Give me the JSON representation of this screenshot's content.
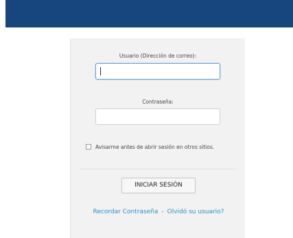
{
  "login": {
    "email_label": "Usuario (Dirección de correo):",
    "password_label": "Contraseña:",
    "email_value": "",
    "password_value": "",
    "remember_label": "Avisarme antes de abrir sesión en otros sitios.",
    "remember_checked": false,
    "submit_label": "INICIAR SESIÓN",
    "forgot_password_link": "Recordar Contraseña",
    "link_separator": "-",
    "forgot_user_link": "Olvidó su usuario?"
  },
  "colors": {
    "header_bar": "#17467e",
    "link": "#2a8fc4",
    "panel_bg": "#f2f2f2"
  }
}
